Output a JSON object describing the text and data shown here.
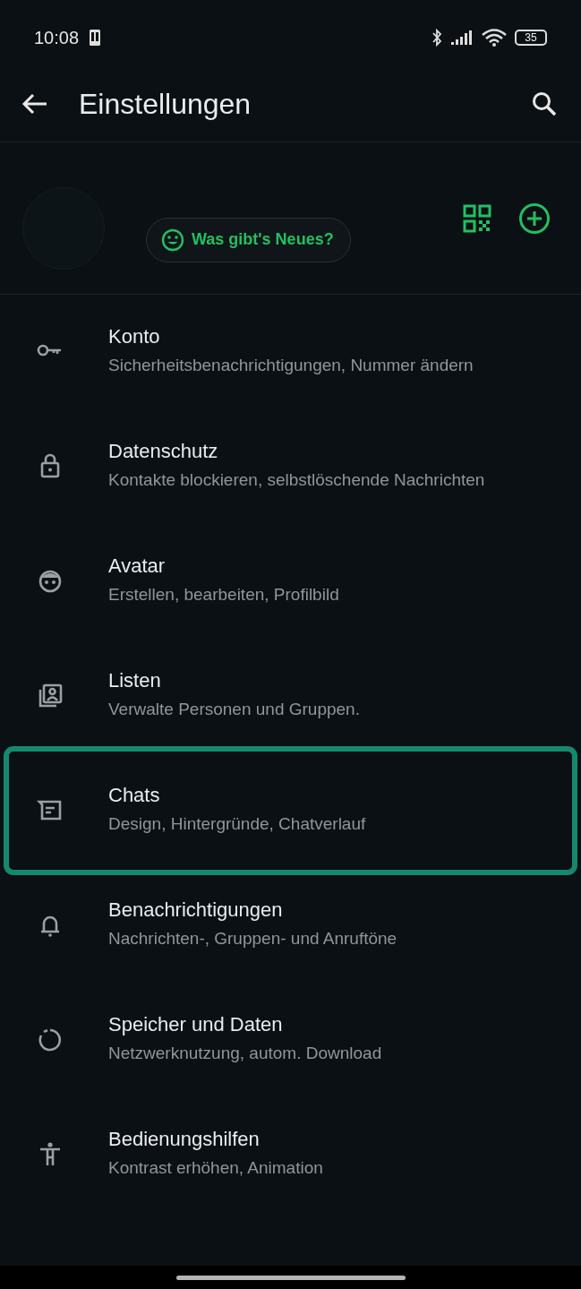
{
  "status_bar": {
    "time": "10:08",
    "battery": "35"
  },
  "header": {
    "title": "Einstellungen"
  },
  "profile": {
    "status_button": "Was gibt's Neues?"
  },
  "settings": [
    {
      "title": "Konto",
      "subtitle": "Sicherheitsbenachrichtigungen, Nummer ändern",
      "highlighted": false
    },
    {
      "title": "Datenschutz",
      "subtitle": "Kontakte blockieren, selbstlöschende Nachrichten",
      "highlighted": false
    },
    {
      "title": "Avatar",
      "subtitle": "Erstellen, bearbeiten, Profilbild",
      "highlighted": false
    },
    {
      "title": "Listen",
      "subtitle": "Verwalte Personen und Gruppen.",
      "highlighted": false
    },
    {
      "title": "Chats",
      "subtitle": "Design, Hintergründe, Chatverlauf",
      "highlighted": true
    },
    {
      "title": "Benachrichtigungen",
      "subtitle": "Nachrichten-, Gruppen- und Anruftöne",
      "highlighted": false
    },
    {
      "title": "Speicher und Daten",
      "subtitle": "Netzwerknutzung, autom. Download",
      "highlighted": false
    },
    {
      "title": "Bedienungshilfen",
      "subtitle": "Kontrast erhöhen, Animation",
      "highlighted": false
    }
  ]
}
